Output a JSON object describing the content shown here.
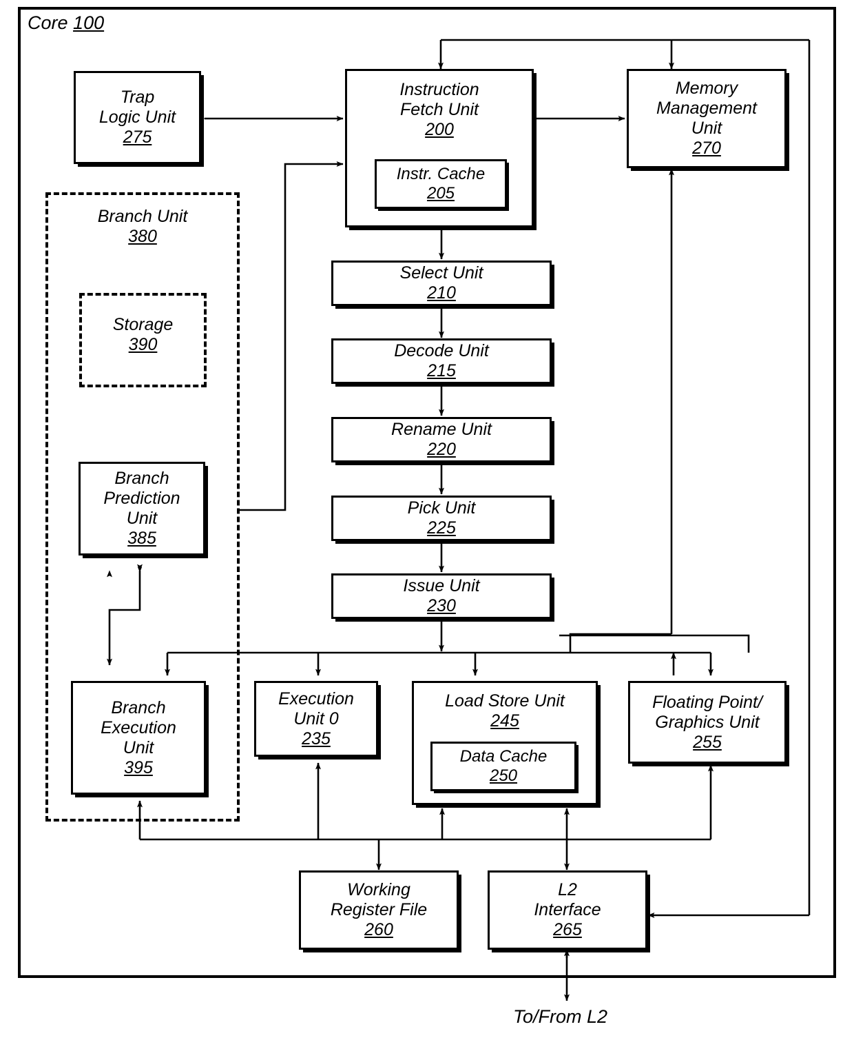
{
  "figure": {
    "outer_label": {
      "name": "Core",
      "num": "100"
    },
    "bottom_caption": "To/From L2"
  },
  "groups": [
    {
      "id": "branch-unit",
      "name": "Branch Unit",
      "num": "380"
    },
    {
      "id": "storage",
      "name": "Storage",
      "num": "390"
    }
  ],
  "blocks": [
    {
      "id": "trap-logic-unit",
      "lines": [
        "Trap",
        "Logic Unit"
      ],
      "num": "275"
    },
    {
      "id": "instruction-fetch-unit",
      "lines": [
        "Instruction",
        "Fetch Unit"
      ],
      "num": "200"
    },
    {
      "id": "instr-cache",
      "lines": [
        "Instr. Cache"
      ],
      "num": "205"
    },
    {
      "id": "memory-management-unit",
      "lines": [
        "Memory",
        "Management",
        "Unit"
      ],
      "num": "270"
    },
    {
      "id": "select-unit",
      "lines": [
        "Select Unit"
      ],
      "num": "210"
    },
    {
      "id": "decode-unit",
      "lines": [
        "Decode Unit"
      ],
      "num": "215"
    },
    {
      "id": "rename-unit",
      "lines": [
        "Rename Unit"
      ],
      "num": "220"
    },
    {
      "id": "pick-unit",
      "lines": [
        "Pick Unit"
      ],
      "num": "225"
    },
    {
      "id": "issue-unit",
      "lines": [
        "Issue Unit"
      ],
      "num": "230"
    },
    {
      "id": "branch-prediction-unit",
      "lines": [
        "Branch",
        "Prediction",
        "Unit"
      ],
      "num": "385"
    },
    {
      "id": "branch-execution-unit",
      "lines": [
        "Branch",
        "Execution",
        "Unit"
      ],
      "num": "395"
    },
    {
      "id": "execution-unit-0",
      "lines": [
        "Execution",
        "Unit 0"
      ],
      "num": "235"
    },
    {
      "id": "load-store-unit",
      "lines": [
        "Load Store Unit"
      ],
      "num": "245"
    },
    {
      "id": "data-cache",
      "lines": [
        "Data Cache"
      ],
      "num": "250"
    },
    {
      "id": "floating-point-graphics-unit",
      "lines": [
        "Floating Point/",
        "Graphics Unit"
      ],
      "num": "255"
    },
    {
      "id": "working-register-file",
      "lines": [
        "Working",
        "Register File"
      ],
      "num": "260"
    },
    {
      "id": "l2-interface",
      "lines": [
        "L2",
        "Interface"
      ],
      "num": "265"
    }
  ]
}
